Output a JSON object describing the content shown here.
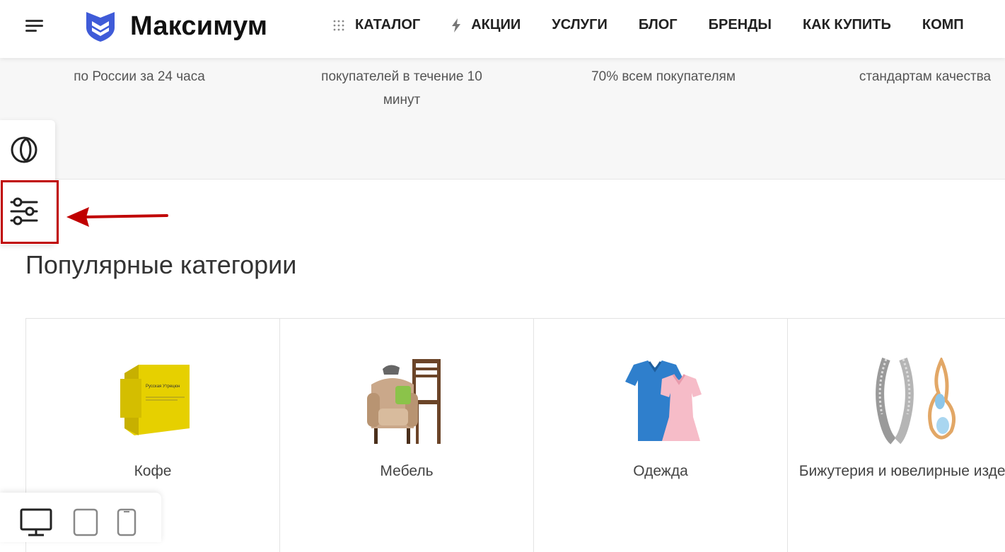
{
  "header": {
    "logo_text": "Максимум",
    "nav": [
      {
        "label": "КАТАЛОГ",
        "icon": "grid-dots-icon"
      },
      {
        "label": "АКЦИИ",
        "icon": "lightning-icon"
      },
      {
        "label": "УСЛУГИ"
      },
      {
        "label": "БЛОГ"
      },
      {
        "label": "БРЕНДЫ"
      },
      {
        "label": "КАК КУПИТЬ"
      },
      {
        "label": "КОМП"
      }
    ]
  },
  "features": [
    {
      "text": "по России за 24 часа"
    },
    {
      "text": "покупателей в течение 10 минут"
    },
    {
      "text": "70% всем покупателям"
    },
    {
      "text": "стандартам качества"
    }
  ],
  "side_panel": {
    "theme_icon": "theme-toggle-icon",
    "settings_icon": "settings-sliders-icon"
  },
  "categories": {
    "title": "Популярные категории",
    "items": [
      {
        "label": "Кофе",
        "icon": "coffee-bag-icon",
        "package_text": "Русская Утрецюн"
      },
      {
        "label": "Мебель",
        "icon": "armchair-icon"
      },
      {
        "label": "Одежда",
        "icon": "clothing-icon"
      },
      {
        "label": "Бижутерия и ювелирные изделия",
        "icon": "jewelry-icon"
      }
    ]
  },
  "devices": [
    {
      "icon": "desktop-icon",
      "active": true
    },
    {
      "icon": "tablet-icon",
      "active": false
    },
    {
      "icon": "phone-icon",
      "active": false
    }
  ],
  "colors": {
    "brand": "#3f5bd8",
    "highlight": "#c00000",
    "text": "#333333"
  }
}
